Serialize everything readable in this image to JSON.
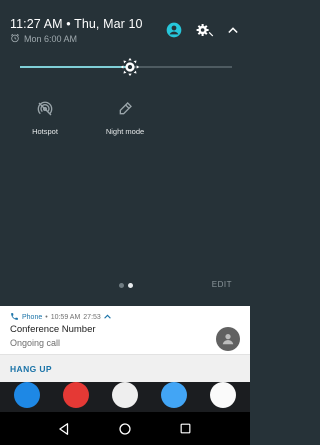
{
  "status": {
    "time_date": "11:27 AM • Thu, Mar 10",
    "alarm": "Mon 6:00 AM"
  },
  "brightness": {
    "level": 0.52
  },
  "tiles": [
    {
      "label": "Hotspot",
      "icon": "hotspot-icon"
    },
    {
      "label": "Night mode",
      "icon": "night-mode-icon"
    }
  ],
  "pager": {
    "pages": 2,
    "active": 1
  },
  "edit_label": "EDIT",
  "notification": {
    "app": "Phone",
    "time": "10:59 AM",
    "duration": "27:53",
    "title": "Conference Number",
    "text": "Ongoing call",
    "action": "HANG UP"
  },
  "colors": {
    "panel": "#263238",
    "accent": "#7fcfd7",
    "notification_accent": "#1a73a8"
  }
}
